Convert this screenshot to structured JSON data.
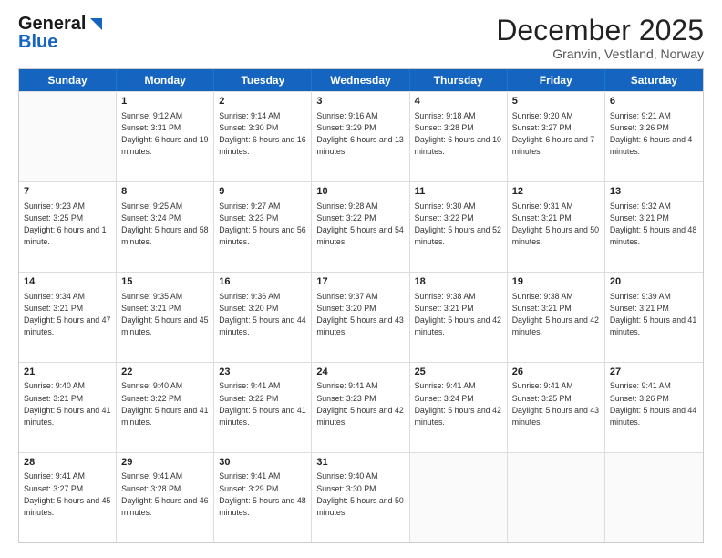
{
  "header": {
    "logo_line1": "General",
    "logo_line2": "Blue",
    "month_title": "December 2025",
    "location": "Granvin, Vestland, Norway"
  },
  "days_of_week": [
    "Sunday",
    "Monday",
    "Tuesday",
    "Wednesday",
    "Thursday",
    "Friday",
    "Saturday"
  ],
  "weeks": [
    [
      {
        "day": "",
        "sunrise": "",
        "sunset": "",
        "daylight": ""
      },
      {
        "day": "1",
        "sunrise": "9:12 AM",
        "sunset": "3:31 PM",
        "daylight": "6 hours and 19 minutes."
      },
      {
        "day": "2",
        "sunrise": "9:14 AM",
        "sunset": "3:30 PM",
        "daylight": "6 hours and 16 minutes."
      },
      {
        "day": "3",
        "sunrise": "9:16 AM",
        "sunset": "3:29 PM",
        "daylight": "6 hours and 13 minutes."
      },
      {
        "day": "4",
        "sunrise": "9:18 AM",
        "sunset": "3:28 PM",
        "daylight": "6 hours and 10 minutes."
      },
      {
        "day": "5",
        "sunrise": "9:20 AM",
        "sunset": "3:27 PM",
        "daylight": "6 hours and 7 minutes."
      },
      {
        "day": "6",
        "sunrise": "9:21 AM",
        "sunset": "3:26 PM",
        "daylight": "6 hours and 4 minutes."
      }
    ],
    [
      {
        "day": "7",
        "sunrise": "9:23 AM",
        "sunset": "3:25 PM",
        "daylight": "6 hours and 1 minute."
      },
      {
        "day": "8",
        "sunrise": "9:25 AM",
        "sunset": "3:24 PM",
        "daylight": "5 hours and 58 minutes."
      },
      {
        "day": "9",
        "sunrise": "9:27 AM",
        "sunset": "3:23 PM",
        "daylight": "5 hours and 56 minutes."
      },
      {
        "day": "10",
        "sunrise": "9:28 AM",
        "sunset": "3:22 PM",
        "daylight": "5 hours and 54 minutes."
      },
      {
        "day": "11",
        "sunrise": "9:30 AM",
        "sunset": "3:22 PM",
        "daylight": "5 hours and 52 minutes."
      },
      {
        "day": "12",
        "sunrise": "9:31 AM",
        "sunset": "3:21 PM",
        "daylight": "5 hours and 50 minutes."
      },
      {
        "day": "13",
        "sunrise": "9:32 AM",
        "sunset": "3:21 PM",
        "daylight": "5 hours and 48 minutes."
      }
    ],
    [
      {
        "day": "14",
        "sunrise": "9:34 AM",
        "sunset": "3:21 PM",
        "daylight": "5 hours and 47 minutes."
      },
      {
        "day": "15",
        "sunrise": "9:35 AM",
        "sunset": "3:21 PM",
        "daylight": "5 hours and 45 minutes."
      },
      {
        "day": "16",
        "sunrise": "9:36 AM",
        "sunset": "3:20 PM",
        "daylight": "5 hours and 44 minutes."
      },
      {
        "day": "17",
        "sunrise": "9:37 AM",
        "sunset": "3:20 PM",
        "daylight": "5 hours and 43 minutes."
      },
      {
        "day": "18",
        "sunrise": "9:38 AM",
        "sunset": "3:21 PM",
        "daylight": "5 hours and 42 minutes."
      },
      {
        "day": "19",
        "sunrise": "9:38 AM",
        "sunset": "3:21 PM",
        "daylight": "5 hours and 42 minutes."
      },
      {
        "day": "20",
        "sunrise": "9:39 AM",
        "sunset": "3:21 PM",
        "daylight": "5 hours and 41 minutes."
      }
    ],
    [
      {
        "day": "21",
        "sunrise": "9:40 AM",
        "sunset": "3:21 PM",
        "daylight": "5 hours and 41 minutes."
      },
      {
        "day": "22",
        "sunrise": "9:40 AM",
        "sunset": "3:22 PM",
        "daylight": "5 hours and 41 minutes."
      },
      {
        "day": "23",
        "sunrise": "9:41 AM",
        "sunset": "3:22 PM",
        "daylight": "5 hours and 41 minutes."
      },
      {
        "day": "24",
        "sunrise": "9:41 AM",
        "sunset": "3:23 PM",
        "daylight": "5 hours and 42 minutes."
      },
      {
        "day": "25",
        "sunrise": "9:41 AM",
        "sunset": "3:24 PM",
        "daylight": "5 hours and 42 minutes."
      },
      {
        "day": "26",
        "sunrise": "9:41 AM",
        "sunset": "3:25 PM",
        "daylight": "5 hours and 43 minutes."
      },
      {
        "day": "27",
        "sunrise": "9:41 AM",
        "sunset": "3:26 PM",
        "daylight": "5 hours and 44 minutes."
      }
    ],
    [
      {
        "day": "28",
        "sunrise": "9:41 AM",
        "sunset": "3:27 PM",
        "daylight": "5 hours and 45 minutes."
      },
      {
        "day": "29",
        "sunrise": "9:41 AM",
        "sunset": "3:28 PM",
        "daylight": "5 hours and 46 minutes."
      },
      {
        "day": "30",
        "sunrise": "9:41 AM",
        "sunset": "3:29 PM",
        "daylight": "5 hours and 48 minutes."
      },
      {
        "day": "31",
        "sunrise": "9:40 AM",
        "sunset": "3:30 PM",
        "daylight": "5 hours and 50 minutes."
      },
      {
        "day": "",
        "sunrise": "",
        "sunset": "",
        "daylight": ""
      },
      {
        "day": "",
        "sunrise": "",
        "sunset": "",
        "daylight": ""
      },
      {
        "day": "",
        "sunrise": "",
        "sunset": "",
        "daylight": ""
      }
    ]
  ]
}
